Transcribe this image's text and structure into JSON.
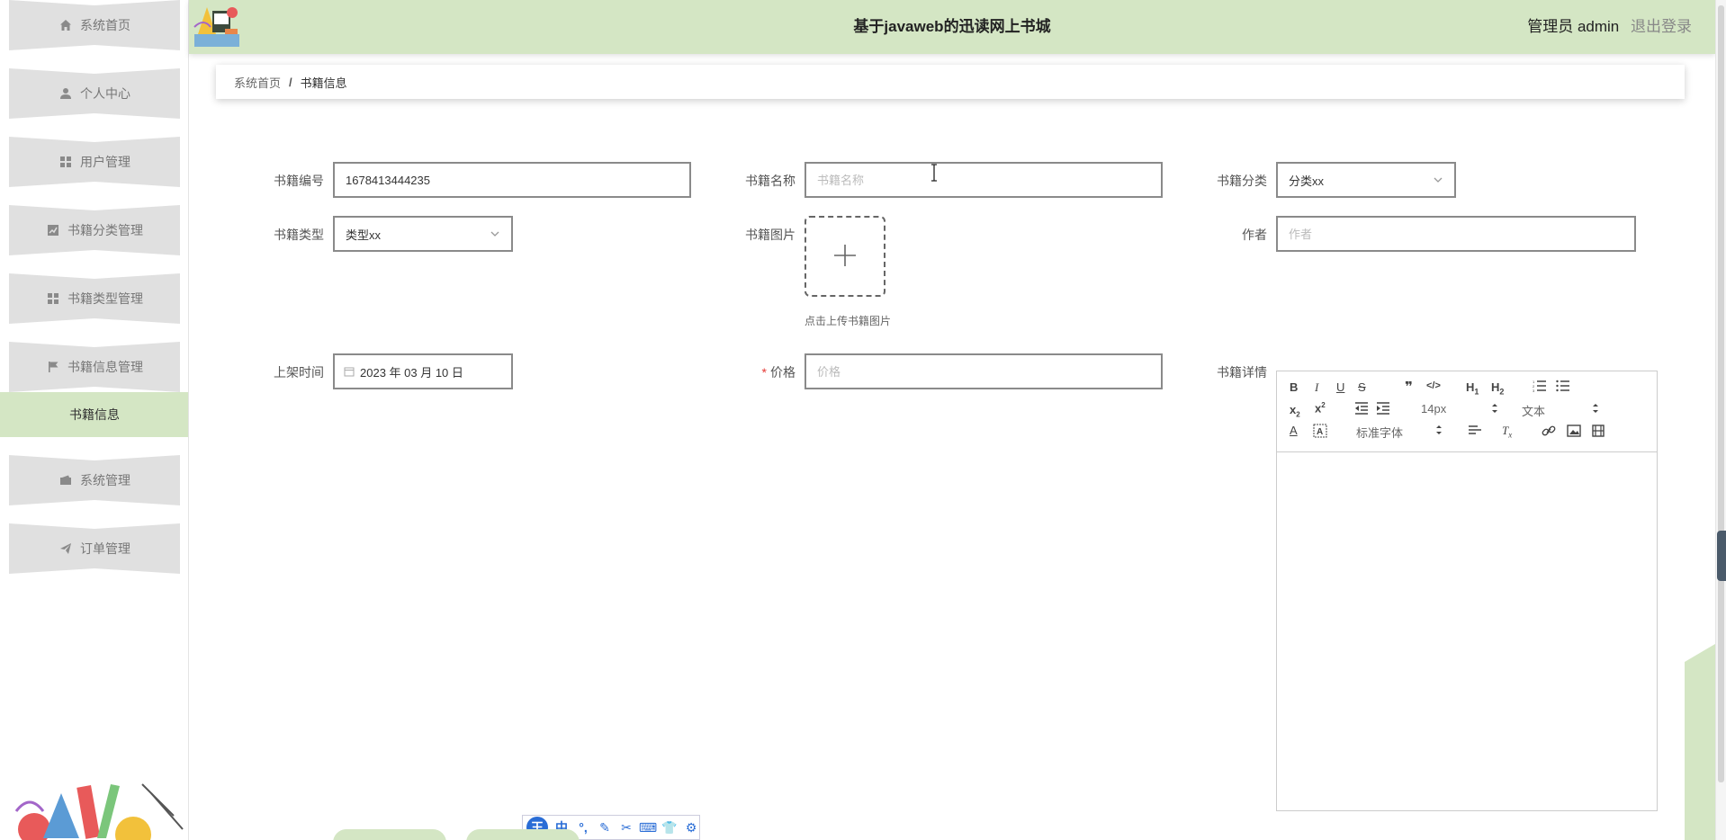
{
  "header": {
    "title": "基于javaweb的迅读网上书城",
    "admin_label": "管理员 admin",
    "logout": "退出登录"
  },
  "sidebar": {
    "items": [
      {
        "label": "系统首页",
        "icon": "home-icon"
      },
      {
        "label": "个人中心",
        "icon": "user-icon"
      },
      {
        "label": "用户管理",
        "icon": "grid-icon"
      },
      {
        "label": "书籍分类管理",
        "icon": "chart-icon"
      },
      {
        "label": "书籍类型管理",
        "icon": "grid-icon"
      },
      {
        "label": "书籍信息管理",
        "icon": "flag-icon"
      },
      {
        "label": "系统管理",
        "icon": "wallet-icon"
      },
      {
        "label": "订单管理",
        "icon": "send-icon"
      }
    ],
    "active_sub": "书籍信息"
  },
  "breadcrumb": {
    "home": "系统首页",
    "separator": "/",
    "current": "书籍信息"
  },
  "form": {
    "book_no": {
      "label": "书籍编号",
      "value": "1678413444235"
    },
    "book_name": {
      "label": "书籍名称",
      "placeholder": "书籍名称"
    },
    "category": {
      "label": "书籍分类",
      "value": "分类xx"
    },
    "type": {
      "label": "书籍类型",
      "value": "类型xx"
    },
    "image": {
      "label": "书籍图片",
      "tip": "点击上传书籍图片"
    },
    "author": {
      "label": "作者",
      "placeholder": "作者"
    },
    "shelf_time": {
      "label": "上架时间",
      "value": "2023 年 03 月 10 日"
    },
    "price": {
      "label": "价格",
      "placeholder": "价格",
      "required_mark": "*"
    },
    "detail": {
      "label": "书籍详情"
    }
  },
  "editor": {
    "font_size": "14px",
    "text_style": "文本",
    "font_family": "标准字体"
  },
  "colors": {
    "accent": "#d4e6c4",
    "nav_bg": "#e0e0e0",
    "ime_blue": "#2a6dd6"
  }
}
